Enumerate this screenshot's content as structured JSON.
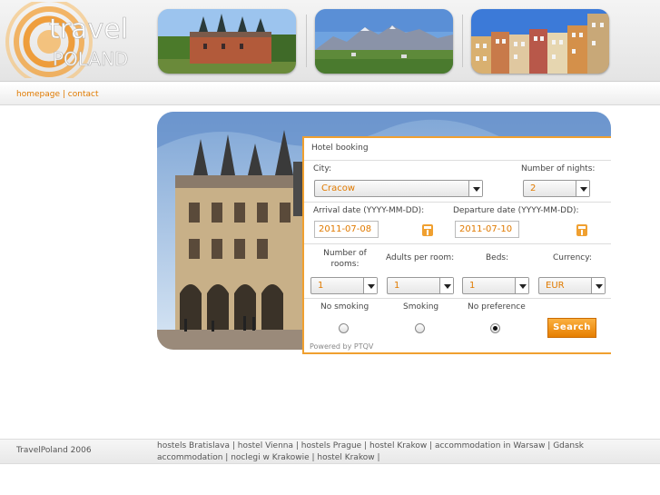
{
  "logo": {
    "line1": "travel",
    "line2": "POLAND"
  },
  "nav": {
    "homepage": "homepage",
    "separator": "|",
    "contact": "contact"
  },
  "booking": {
    "title": "Hotel booking",
    "city_label": "City:",
    "city_value": "Cracow",
    "nights_label": "Number of nights:",
    "nights_value": "2",
    "arrival_label": "Arrival date (YYYY-MM-DD):",
    "arrival_value": "2011-07-08",
    "departure_label": "Departure date (YYYY-MM-DD):",
    "departure_value": "2011-07-10",
    "rooms_label": "Number of rooms:",
    "rooms_value": "1",
    "adults_label": "Adults per room:",
    "adults_value": "1",
    "beds_label": "Beds:",
    "beds_value": "1",
    "currency_label": "Currency:",
    "currency_value": "EUR",
    "no_smoking_label": "No smoking",
    "smoking_label": "Smoking",
    "no_preference_label": "No preference",
    "selected_option": "No preference",
    "search_label": "Search",
    "powered_by": "Powered by PTQV"
  },
  "footer": {
    "copyright": "TravelPoland 2006",
    "links": [
      "hostels Bratislava",
      "hostel Vienna",
      "hostels Prague",
      "hostel Krakow",
      "accommodation in Warsaw",
      "Gdansk accommodation",
      "noclegi w Krakowie",
      "hostel Krakow"
    ]
  },
  "colors": {
    "accent": "#f0a030",
    "link": "#e07a00"
  }
}
